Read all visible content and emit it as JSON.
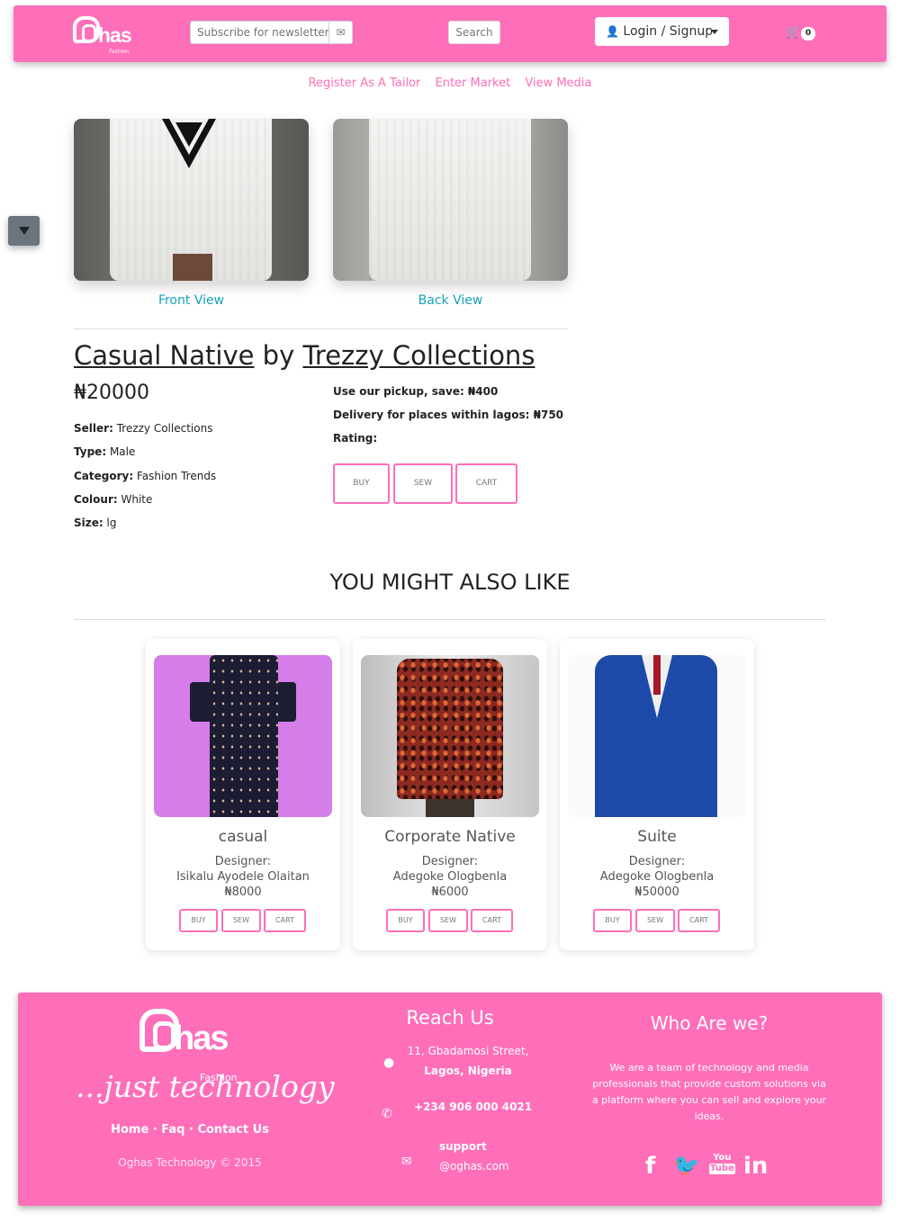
{
  "header": {
    "logo_text": "has",
    "logo_sub": "Fashion",
    "newsletter_placeholder": "Subscribe for newsletter",
    "search_label": "Search",
    "login_label": "Login / Signup",
    "cart_count": "0"
  },
  "subnav": {
    "register": "Register As A Tailor",
    "market": "Enter Market",
    "media": "View Media"
  },
  "product": {
    "front_caption": "Front View",
    "back_caption": "Back View",
    "name": "Casual Native",
    "by": "by",
    "brand": "Trezzy Collections",
    "price": "₦20000",
    "seller_label": "Seller:",
    "seller": "Trezzy Collections",
    "type_label": "Type:",
    "type": "Male",
    "category_label": "Category:",
    "category": "Fashion Trends",
    "colour_label": "Colour:",
    "colour": "White",
    "size_label": "Size:",
    "size": "lg",
    "pickup": "Use our pickup, save: ₦400",
    "delivery": "Delivery for places within lagos: ₦750",
    "rating": "Rating:",
    "buy": "BUY",
    "sew": "SEW",
    "cart": "CART"
  },
  "also_like": {
    "title": "YOU MIGHT ALSO LIKE",
    "designer_label": "Designer:",
    "buy": "BUY",
    "sew": "SEW",
    "cart": "CART",
    "items": [
      {
        "name": "casual",
        "designer": "Isikalu Ayodele Olaitan",
        "price": "₦8000"
      },
      {
        "name": "Corporate Native",
        "designer": "Adegoke Ologbenla",
        "price": "₦6000"
      },
      {
        "name": "Suite",
        "designer": "Adegoke Ologbenla",
        "price": "₦50000"
      }
    ]
  },
  "footer": {
    "logo_text": "has",
    "logo_sub": "Fashion",
    "tagline": "...just technology",
    "links": "Home · Faq · Contact Us",
    "copyright": "Oghas Technology © 2015",
    "reach_title": "Reach Us",
    "address_line1": "11, Gbadamosi Street,",
    "address_line2": "Lagos, Nigeria",
    "phone": "+234 906 000 4021",
    "email_line1": "support",
    "email_line2": "@oghas.com",
    "who_title": "Who Are we?",
    "about": "We are a team of technology and media professionals that provide custom solutions via a platform where you can sell and explore your ideas.",
    "social": {
      "facebook": "f",
      "youtube_top": "You",
      "youtube_bottom": "Tube",
      "linkedin": "in"
    }
  },
  "colors": {
    "brand_pink": "#ff6eb9",
    "teal": "#17a2b8"
  },
  "icons": [
    "envelope-icon",
    "user-icon",
    "cart-icon",
    "filter-icon",
    "map-marker-icon",
    "phone-icon",
    "facebook-icon",
    "twitter-icon",
    "youtube-icon",
    "linkedin-icon"
  ]
}
